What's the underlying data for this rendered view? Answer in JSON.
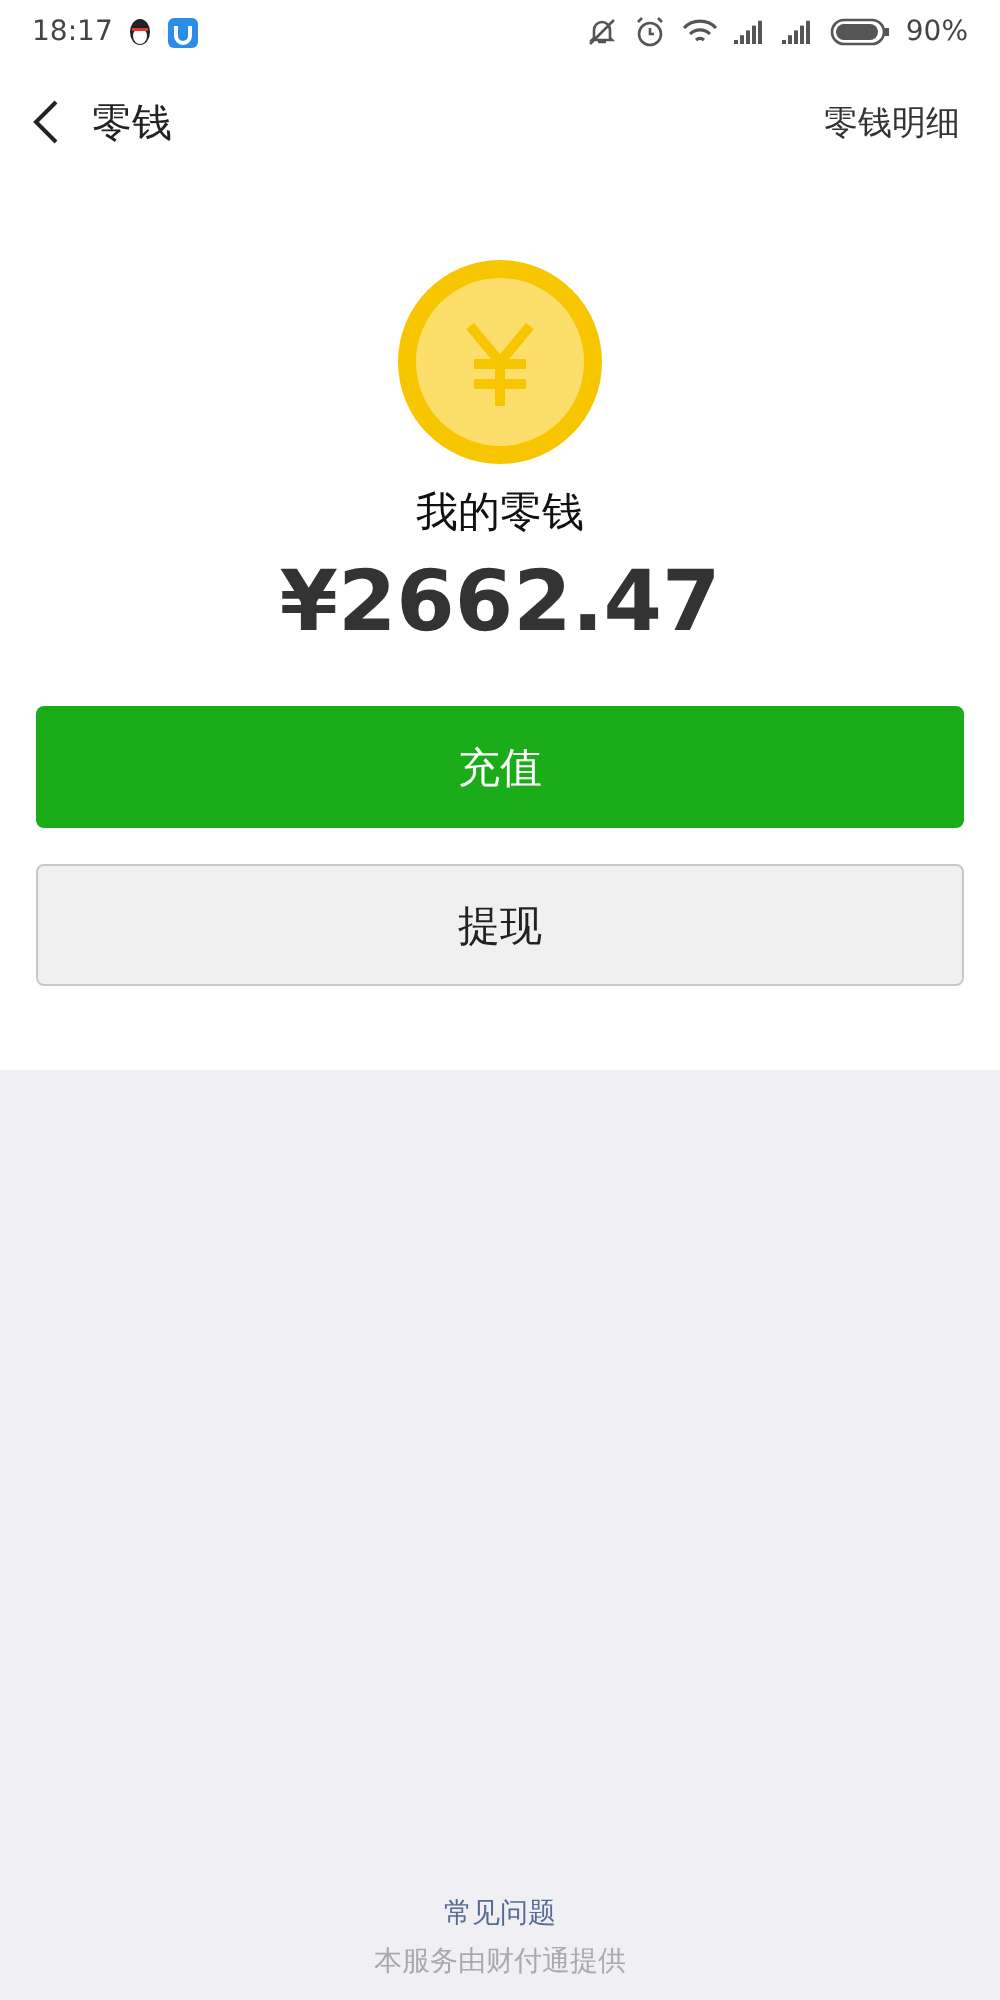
{
  "status_bar": {
    "time": "18:17",
    "battery": "90%"
  },
  "nav": {
    "title": "零钱",
    "action": "零钱明细"
  },
  "balance": {
    "label": "我的零钱",
    "amount": "¥2662.47"
  },
  "buttons": [
    {
      "label": "充值",
      "kind": "primary"
    },
    {
      "label": "提现",
      "kind": "secondary"
    }
  ],
  "footer": {
    "link": "常见问题",
    "note": "本服务由财付通提供"
  }
}
